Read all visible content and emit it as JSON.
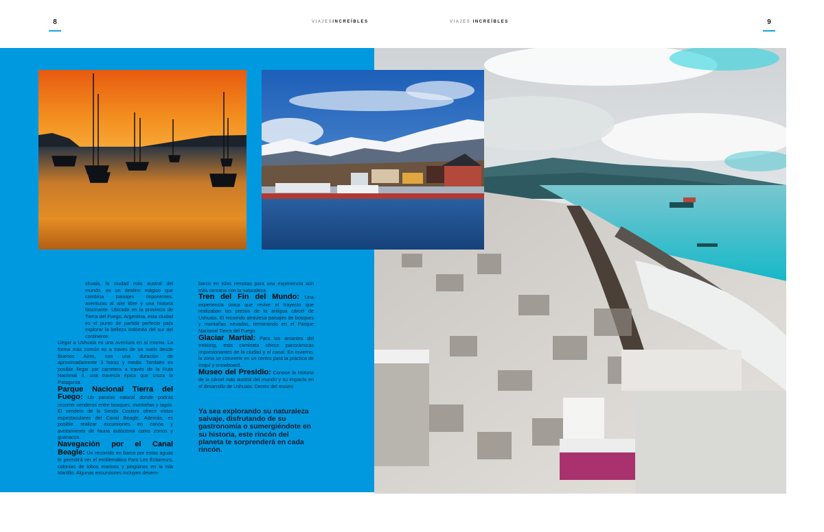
{
  "header": {
    "left_page_number": "8",
    "right_page_number": "9",
    "left_running_head_light": "VIAJES",
    "left_running_head_bold": "INCREÍBLES",
    "right_running_head_light": "VIAJES",
    "right_running_head_bold": "INCREÍBLES",
    "accent_color": "#1aa0e6"
  },
  "layout_colors": {
    "panel_blue": "#0099e0"
  },
  "photos": {
    "sunset": "sailboats-sunset-photo",
    "harbor": "ushuaia-harbor-mountains-photo",
    "aerial": "ushuaia-aerial-snow-photo"
  },
  "left_column": {
    "intro": "shuaia, la ciudad más austral del mundo, es un destino mágico que combina paisajes imponentes, aventuras al aire libre y una historia fascinante. Ubicada en la provincia de Tierra del Fuego, Argentina, esta ciudad es el punto de partida perfecto para explorar la belleza indómita del sur del continente.",
    "travel": "Llegar a Ushuaia es una aventura en sí misma. La forma más común es a través de un vuelo desde Buenos Aires, con una duración de aproximadamente 3 horas y media. También es posible llegar por carretera a través de la Ruta Nacional 3, una travesía épica que cruza la Patagonia.",
    "section1_title": "Parque Nacional Tierra del Fuego:",
    "section1_text": "Un paraíso natural donde podrás recorrer senderos entre bosques, montañas y lagos. El sendero de la Senda Costera ofrece vistas espectaculares del Canal Beagle. Además, es posible realizar excursiones en canoa y avistamiento de fauna autóctona como zorros y guanacos.",
    "section2_title": "Navegación por el Canal Beagle:",
    "section2_text": "Un recorrido en barco por estas aguas te permitirá ver el emblemático Faro Les Éclaireurs, colonias de lobos marinos y pingüinos en la Isla Martillo. Algunas excursiones incluyen desem-"
  },
  "right_column": {
    "continuation": "barco en islas remotas para una experiencia aún más cercana con la naturaleza.",
    "section3_title": "Tren del Fin del Mundo:",
    "section3_text": "Una experiencia única que revive el trayecto que realizaban los presos de la antigua cárcel de Ushuaia. El recorrido atraviesa paisajes de bosques y montañas nevadas, terminando en el Parque Nacional Tierra del Fuego.",
    "section4_title": "Glaciar Martial:",
    "section4_text": "Para los amantes del trekking, esta caminata ofrece panorámicas impresionantes de la ciudad y el canal. En invierno, la zona se convierte en un centro para la práctica de esquí y snowboard.",
    "section5_title": "Museo del Presidio:",
    "section5_text": "Conoce la historia de la cárcel más austral del mundo y su impacto en el desarrollo de Ushuaia. Dentro del museo",
    "closing": "Ya sea explorando su naturaleza salvaje, disfrutando de su gastronomía o sumergiéndote en su historia, este rincón del planeta te sorprenderá en cada rincón."
  }
}
